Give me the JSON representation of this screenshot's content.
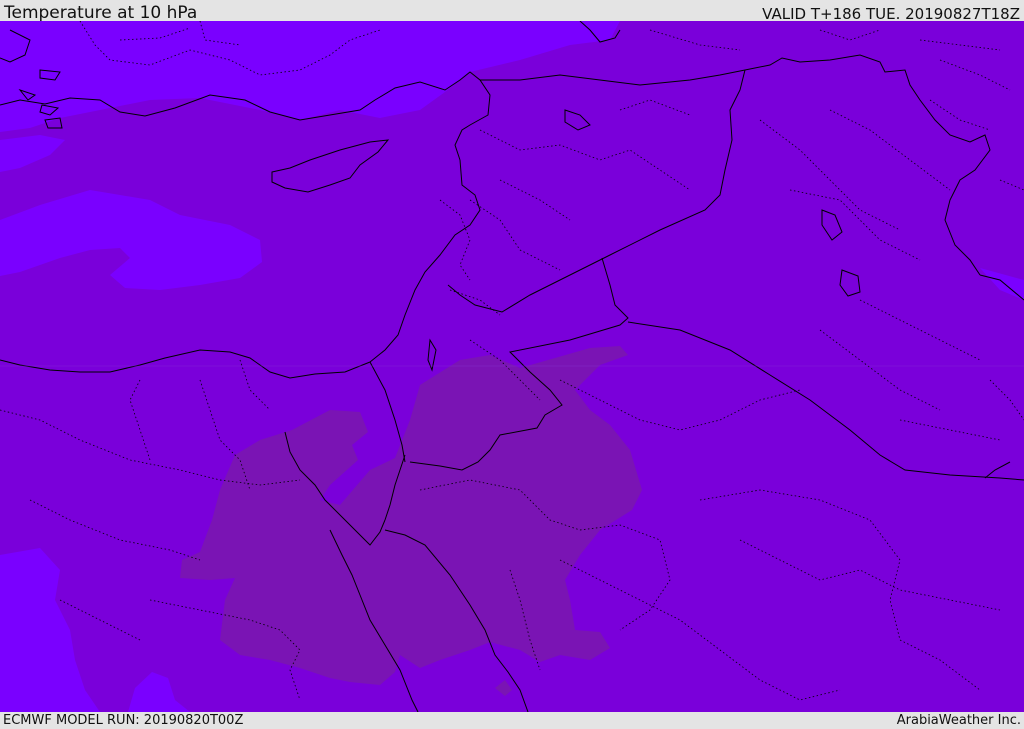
{
  "header": {
    "title": "Temperature at 10 hPa",
    "valid_time": "VALID T+186 TUE. 20190827T18Z"
  },
  "footer": {
    "model_run": "ECMWF MODEL RUN: 20190820T00Z",
    "credit": "ArabiaWeather Inc."
  },
  "map": {
    "region": "Eastern Mediterranean and Middle East",
    "colors": {
      "base_field": "#7a00da",
      "cold_field": "#7a00ff",
      "warm_field": "#7a14b4",
      "coastline": "#000000",
      "border": "#000000"
    }
  }
}
